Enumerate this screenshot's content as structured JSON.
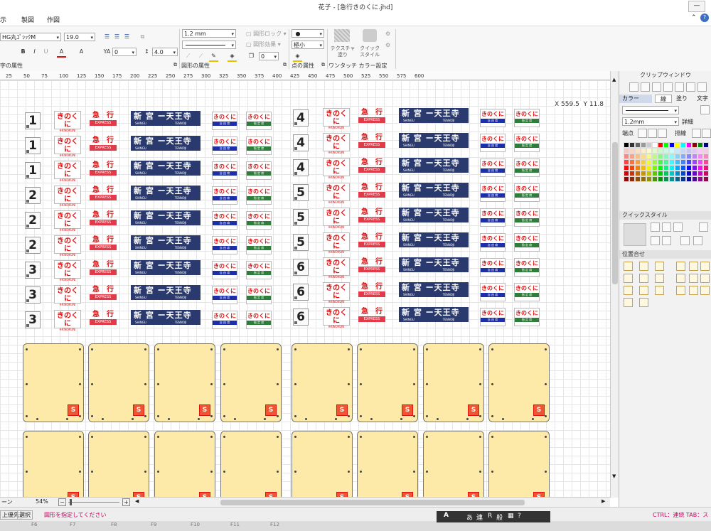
{
  "window": {
    "title": "花子 - [急行きのくに.jhd]",
    "help_icon": "?"
  },
  "menu": [
    "示",
    "製図",
    "作図"
  ],
  "ribbon": {
    "font_name": "HG丸ｺﾞｼｯｸM",
    "font_size": "19.0",
    "char_spacing": "0",
    "line_spacing": "4.0",
    "char_attr_label": "字の属性",
    "line_width": "1.2 mm",
    "shape_lock": "図形ロック",
    "shape_effect": "図形効果",
    "effect_value": "0",
    "shape_attr_label": "図形の属性",
    "point_size": "極小",
    "point_attr_label": "点の属性",
    "texture_label": "テクスチャ\n塗り",
    "quick_style_label": "クイック\nスタイル",
    "onetouch_label": "ワンタッチ カラー設定"
  },
  "ruler": [
    "25",
    "50",
    "75",
    "100",
    "125",
    "150",
    "175",
    "200",
    "225",
    "250",
    "275",
    "300",
    "325",
    "350",
    "375",
    "400",
    "425",
    "450",
    "475",
    "500",
    "525",
    "550",
    "575",
    "600"
  ],
  "coord": {
    "x": "X  559.5",
    "y": "Y  11.8"
  },
  "signs": {
    "kino_big": "きのくに",
    "kino_small": "※KINOKUNI",
    "kyuko_big": "急　行",
    "kyuko_small": "EXPRESS",
    "dest_big": "新 宮 ー天王寺",
    "dest_small_left": "SHINGU",
    "dest_small_right": "TENNOJI",
    "car_reserved": "指 定 席",
    "car_free": "自 由 席",
    "left_numbers": [
      "1",
      "1",
      "1",
      "2",
      "2",
      "2",
      "3",
      "3",
      "3"
    ],
    "right_numbers": [
      "4",
      "4",
      "4",
      "5",
      "5",
      "5",
      "6",
      "6",
      "6"
    ]
  },
  "panel_icon": "S",
  "zoom": "54%",
  "rightpane": {
    "clip_window": "クリップウィンドウ",
    "tab_color": "カラー",
    "tab_line": "線",
    "tab_fill": "塗り",
    "tab_text": "文字",
    "line_width": "1.2mm",
    "detail": "詳細",
    "end_label": "端点",
    "sort_label": "排線",
    "quick_style": "クイックスタイル",
    "align": "位置合せ"
  },
  "status": {
    "left_a": "ーン",
    "priority": "上優先",
    "select": "選択",
    "message": "図形を指定してください",
    "hint": "CTRL：連続 TAB：ス"
  },
  "fkeys": [
    "F6",
    "F7",
    "F8",
    "F9",
    "F10",
    "F11",
    "F12"
  ],
  "ime": [
    "あ",
    "連",
    "R",
    "般"
  ],
  "colors": {
    "red": "#dd1111",
    "navy": "#2b3a6e",
    "panel": "#fde9a8",
    "message": "#cc0066"
  }
}
